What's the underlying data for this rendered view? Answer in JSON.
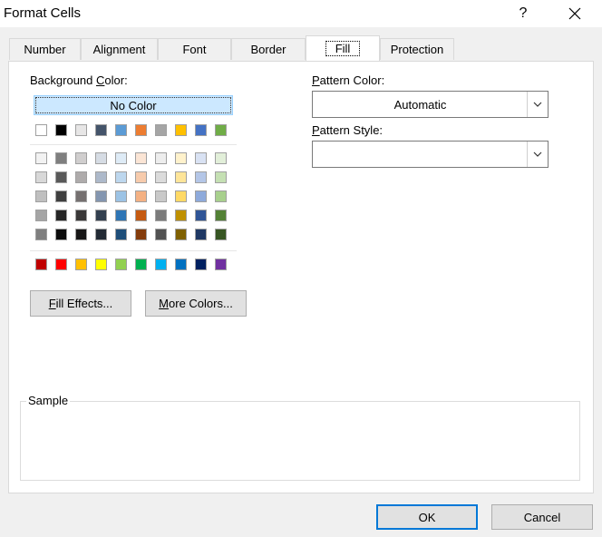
{
  "window": {
    "title": "Format Cells",
    "help_label": "?"
  },
  "tabs": [
    {
      "label": "Number"
    },
    {
      "label": "Alignment"
    },
    {
      "label": "Font"
    },
    {
      "label": "Border"
    },
    {
      "label": "Fill",
      "selected": true
    },
    {
      "label": "Protection"
    }
  ],
  "fill": {
    "background_color": {
      "label_pre": "Background ",
      "label_key": "C",
      "label_post": "olor:"
    },
    "no_color_label": "No Color",
    "theme_colors": [
      "#ffffff",
      "#000000",
      "#e7e6e6",
      "#44546a",
      "#5b9bd5",
      "#ed7d31",
      "#a5a5a5",
      "#ffc000",
      "#4472c4",
      "#70ad47"
    ],
    "tint_rows": [
      [
        "#f2f2f2",
        "#7f7f7f",
        "#d0cece",
        "#d6dce4",
        "#deebf6",
        "#fbe5d5",
        "#ededed",
        "#fff2cc",
        "#d9e2f3",
        "#e2efd9"
      ],
      [
        "#d8d8d8",
        "#595959",
        "#aeabab",
        "#adb9ca",
        "#bdd7ee",
        "#f7cbac",
        "#dbdbdb",
        "#fee599",
        "#b4c6e7",
        "#c5e0b3"
      ],
      [
        "#bfbfbf",
        "#3f3f3f",
        "#757070",
        "#8496b0",
        "#9cc3e5",
        "#f4b183",
        "#c9c9c9",
        "#ffd965",
        "#8eaadb",
        "#a8d08d"
      ],
      [
        "#a5a5a5",
        "#262626",
        "#3a3838",
        "#323f4f",
        "#2e75b5",
        "#c55a11",
        "#7b7b7b",
        "#bf9000",
        "#2f5496",
        "#538135"
      ],
      [
        "#7f7f7f",
        "#0c0c0c",
        "#171616",
        "#222a35",
        "#1e4e79",
        "#843c0b",
        "#525252",
        "#7f6000",
        "#1f3864",
        "#375623"
      ]
    ],
    "standard_colors": [
      "#c00000",
      "#ff0000",
      "#ffc000",
      "#ffff00",
      "#92d050",
      "#00b050",
      "#00b0f0",
      "#0070c0",
      "#002060",
      "#7030a0"
    ],
    "fill_effects": {
      "key": "F",
      "rest": "ill Effects..."
    },
    "more_colors": {
      "key": "M",
      "rest": "ore Colors..."
    },
    "pattern_color": {
      "label_pre": "",
      "label_key": "P",
      "label_post": "attern Color:",
      "value": "Automatic"
    },
    "pattern_style": {
      "label_pre": "",
      "label_key": "P",
      "label_post": "attern Style:",
      "value": ""
    },
    "sample_label": "Sample"
  },
  "footer": {
    "ok_label": "OK",
    "cancel_label": "Cancel"
  },
  "icons": {
    "close": "close-icon",
    "dropdown": "chevron-down-icon"
  },
  "accent_color": "#0078d7"
}
